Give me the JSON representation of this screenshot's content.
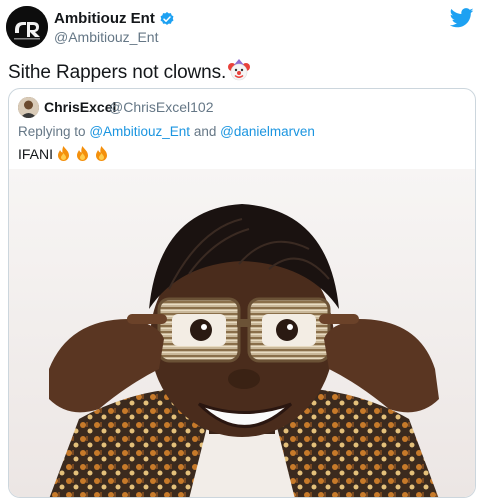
{
  "tweet": {
    "display_name": "Ambitiouz Ent",
    "handle": "@Ambitiouz_Ent",
    "text": "Sithe Rappers not clowns.",
    "emoji_icon": "clown-face-icon"
  },
  "quoted": {
    "display_name": "ChrisExcel",
    "handle": "@ChrisExcel102",
    "reply_prefix": "Replying to",
    "reply_mention_1": "@Ambitiouz_Ent",
    "reply_and": "and",
    "reply_mention_2": "@danielmarven",
    "text": "IFANI",
    "emoji_icons": [
      "fire-icon",
      "fire-icon",
      "fire-icon"
    ]
  },
  "colors": {
    "twitter_blue": "#1da1f2",
    "mention_blue": "#1b95e0",
    "secondary_text": "#657786",
    "border": "#ccd6dd"
  }
}
